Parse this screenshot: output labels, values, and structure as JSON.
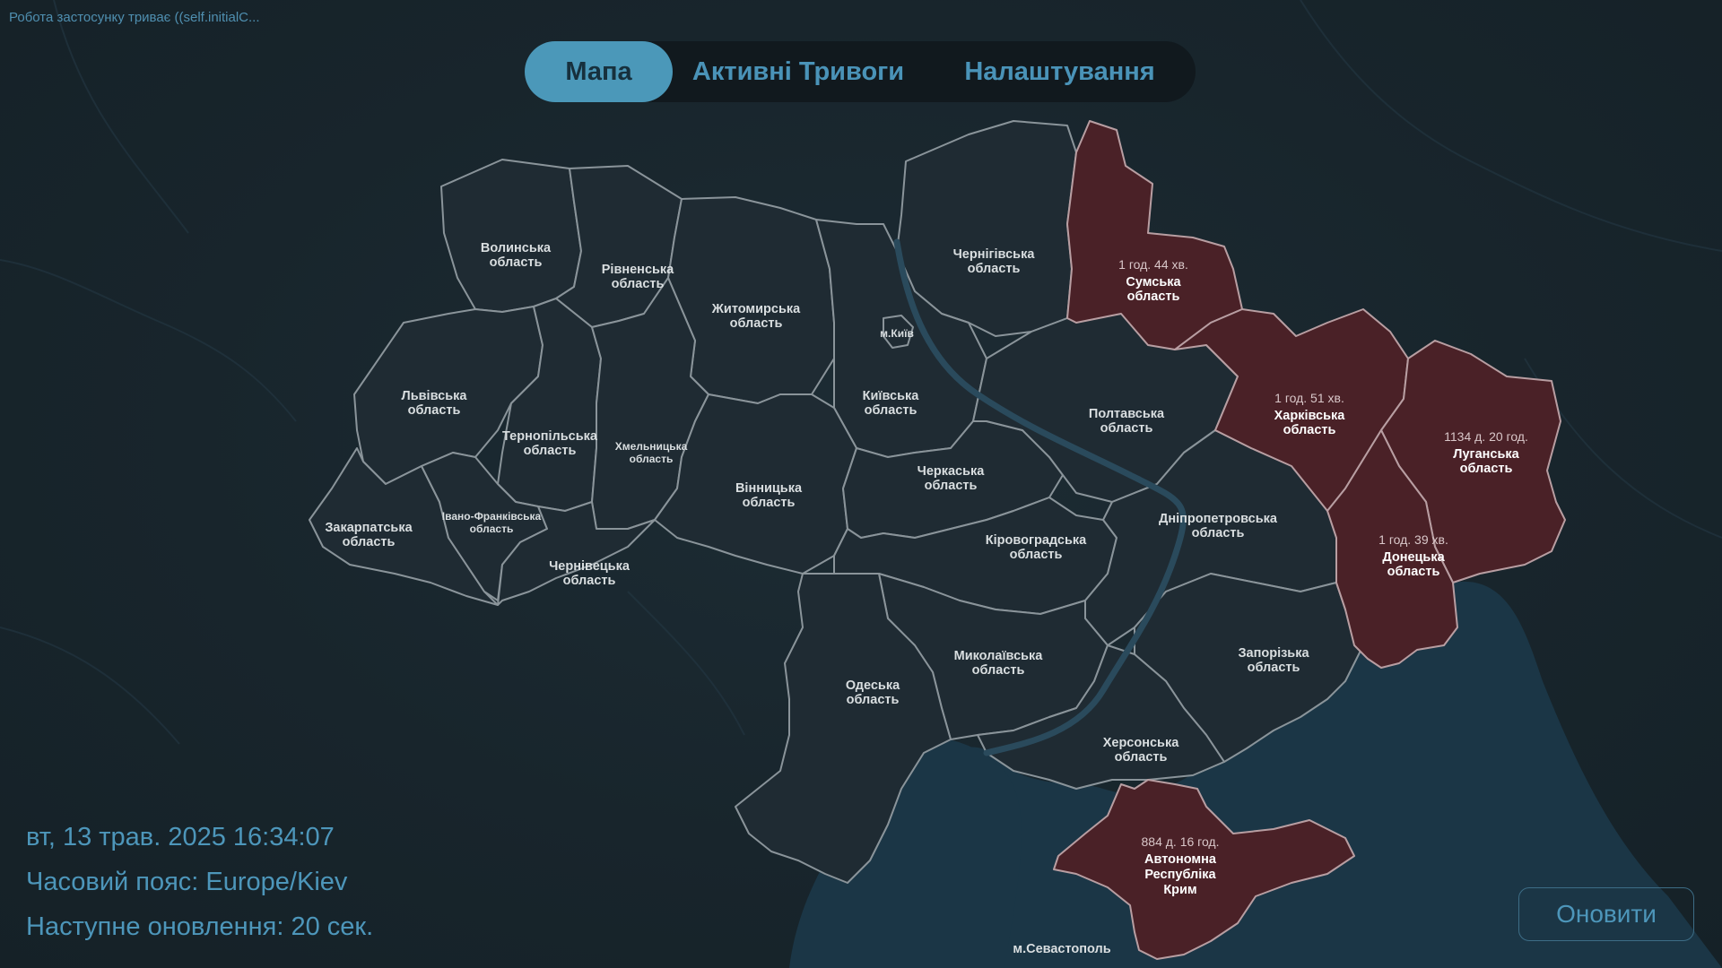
{
  "status_banner": "Робота застосунку триває ((self.initialC...",
  "tabs": [
    {
      "label": "Мапа",
      "active": true
    },
    {
      "label": "Активні Тривоги",
      "active": false
    },
    {
      "label": "Налаштування",
      "active": false
    }
  ],
  "map": {
    "regions": [
      {
        "id": "volyn",
        "name_line1": "Волинська",
        "name_line2": "область"
      },
      {
        "id": "rivne",
        "name_line1": "Рівненська",
        "name_line2": "область"
      },
      {
        "id": "zhytomyr",
        "name_line1": "Житомирська",
        "name_line2": "область"
      },
      {
        "id": "kyiv-city",
        "name_line1": "м.Київ",
        "name_line2": ""
      },
      {
        "id": "chernihiv",
        "name_line1": "Чернігівська",
        "name_line2": "область"
      },
      {
        "id": "lviv",
        "name_line1": "Львівська",
        "name_line2": "область"
      },
      {
        "id": "ternopil",
        "name_line1": "Тернопільська",
        "name_line2": "область"
      },
      {
        "id": "khmelnytskyi",
        "name_line1": "Хмельницька",
        "name_line2": "область"
      },
      {
        "id": "kyiv-oblast",
        "name_line1": "Київська",
        "name_line2": "область"
      },
      {
        "id": "poltava",
        "name_line1": "Полтавська",
        "name_line2": "область"
      },
      {
        "id": "cherkasy",
        "name_line1": "Черкаська",
        "name_line2": "область"
      },
      {
        "id": "vinnytsia",
        "name_line1": "Вінницька",
        "name_line2": "область"
      },
      {
        "id": "zakarpattia",
        "name_line1": "Закарпатська",
        "name_line2": "область"
      },
      {
        "id": "ivano-frankivsk",
        "name_line1": "Івано-Франківська",
        "name_line2": "область"
      },
      {
        "id": "chernivtsi",
        "name_line1": "Чернівецька",
        "name_line2": "область"
      },
      {
        "id": "kirovohrad",
        "name_line1": "Кіровоградська",
        "name_line2": "область"
      },
      {
        "id": "dnipro",
        "name_line1": "Дніпропетровська",
        "name_line2": "область"
      },
      {
        "id": "mykolaiv",
        "name_line1": "Миколаївська",
        "name_line2": "область"
      },
      {
        "id": "odesa",
        "name_line1": "Одеська",
        "name_line2": "область"
      },
      {
        "id": "zaporizhzhia",
        "name_line1": "Запорізька",
        "name_line2": "область"
      },
      {
        "id": "kherson",
        "name_line1": "Херсонська",
        "name_line2": "область"
      },
      {
        "id": "sevastopol",
        "name_line1": "м.Севастополь",
        "name_line2": ""
      }
    ],
    "alert_regions": [
      {
        "id": "sumy",
        "duration": "1 год. 44 хв.",
        "name_line1": "Сумська",
        "name_line2": "область"
      },
      {
        "id": "kharkiv",
        "duration": "1 год. 51 хв.",
        "name_line1": "Харківська",
        "name_line2": "область"
      },
      {
        "id": "luhansk",
        "duration": "1134 д. 20 год.",
        "name_line1": "Луганська",
        "name_line2": "область"
      },
      {
        "id": "donetsk",
        "duration": "1 год. 39 хв.",
        "name_line1": "Донецька",
        "name_line2": "область"
      },
      {
        "id": "crimea",
        "duration": "884 д. 16 год.",
        "name_line1": "Автономна",
        "name_line2": "Республіка",
        "name_line3": "Крим"
      }
    ],
    "colors": {
      "background": "#17242b",
      "region_fill": "#1f2b33",
      "region_border": "#8a949a",
      "alert_fill": "#4a2127",
      "sea": "#1b3646",
      "accent": "#4b98b9"
    }
  },
  "info": {
    "datetime": "вт, 13 трав. 2025 16:34:07",
    "timezone": "Часовий пояс: Europe/Kiev",
    "next_update": "Наступне оновлення: 20 сек."
  },
  "refresh_label": "Оновити"
}
